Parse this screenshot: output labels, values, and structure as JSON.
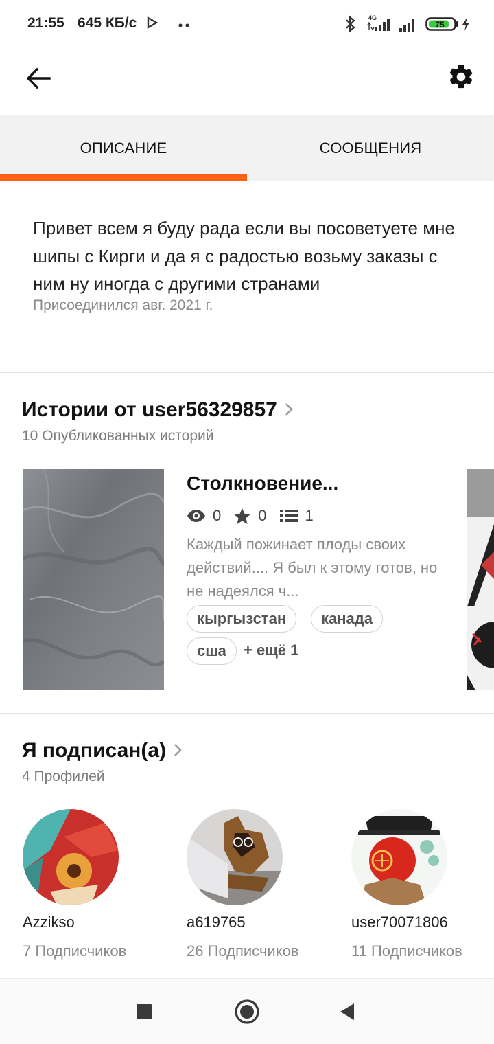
{
  "status_bar": {
    "time": "21:55",
    "speed": "645 КБ/с",
    "network": "4G",
    "battery": "75"
  },
  "tabs": [
    {
      "label": "ОПИСАНИЕ",
      "active": true
    },
    {
      "label": "СООБЩЕНИЯ",
      "active": false
    }
  ],
  "accent_color": "#ff6214",
  "description": {
    "text": "Привет всем я буду рада если вы посоветуете мне шипы с Кирги и да я с радостью возьму заказы с ним ну иногда с другими странами",
    "joined": "Присоединился авг. 2021 г."
  },
  "stories": {
    "title": "Истории от user56329857",
    "subtitle": "10 Опубликованных историй",
    "items": [
      {
        "title": "Столкновение...",
        "views": "0",
        "votes": "0",
        "parts": "1",
        "description": "Каждый пожинает плоды своих действий.... Я был к этому готов, но не надеялся ч...",
        "tags": [
          "кыргызстан",
          "канада",
          "сша"
        ],
        "more_tags": "+ ещё 1"
      }
    ]
  },
  "following": {
    "title": "Я подписан(а)",
    "subtitle": "4 Профилей",
    "profiles": [
      {
        "name": "Azzikso",
        "followers": "7 Подписчиков"
      },
      {
        "name": "a619765",
        "followers": "26 Подписчиков"
      },
      {
        "name": "user70071806",
        "followers": "11 Подписчиков"
      }
    ]
  }
}
